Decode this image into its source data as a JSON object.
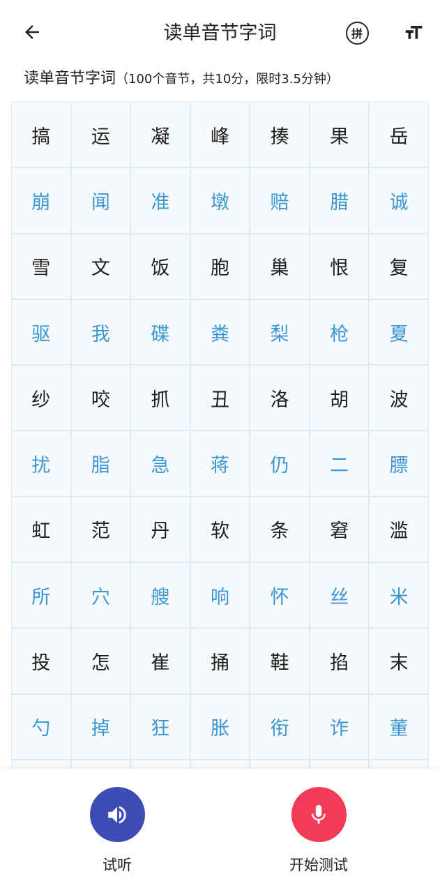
{
  "header": {
    "title": "读单音节字词",
    "pinyin_label": "拼"
  },
  "icons": {
    "back": "arrow-left-icon",
    "pinyin": "pinyin-toggle-icon",
    "font_size": "text-size-icon",
    "listen": "speaker-icon",
    "start": "microphone-icon"
  },
  "subtitle": {
    "main": "读单音节字词",
    "note": "（100个音节，共10分，限时3.5分钟）"
  },
  "grid": {
    "rows": [
      [
        "搞",
        "运",
        "凝",
        "峰",
        "揍",
        "果",
        "岳"
      ],
      [
        "崩",
        "闻",
        "准",
        "墩",
        "赔",
        "腊",
        "诚"
      ],
      [
        "雪",
        "文",
        "饭",
        "胞",
        "巢",
        "恨",
        "复"
      ],
      [
        "驱",
        "我",
        "碟",
        "粪",
        "梨",
        "枪",
        "夏"
      ],
      [
        "纱",
        "咬",
        "抓",
        "丑",
        "洛",
        "胡",
        "波"
      ],
      [
        "扰",
        "脂",
        "急",
        "蒋",
        "仍",
        "二",
        "膘"
      ],
      [
        "虹",
        "范",
        "丹",
        "软",
        "条",
        "窘",
        "滥"
      ],
      [
        "所",
        "穴",
        "艘",
        "响",
        "怀",
        "丝",
        "米"
      ],
      [
        "投",
        "怎",
        "崔",
        "捅",
        "鞋",
        "掐",
        "末"
      ],
      [
        "勺",
        "掉",
        "狂",
        "胀",
        "衔",
        "诈",
        "董"
      ],
      [
        "",
        "",
        "",
        "",
        "",
        "",
        ""
      ]
    ]
  },
  "bottom": {
    "listen_label": "试听",
    "start_label": "开始测试"
  },
  "colors": {
    "accent_blue": "#3a97d4",
    "listen_button": "#3e4db6",
    "record_button": "#f33b58",
    "cell_border": "#dcecf6"
  }
}
